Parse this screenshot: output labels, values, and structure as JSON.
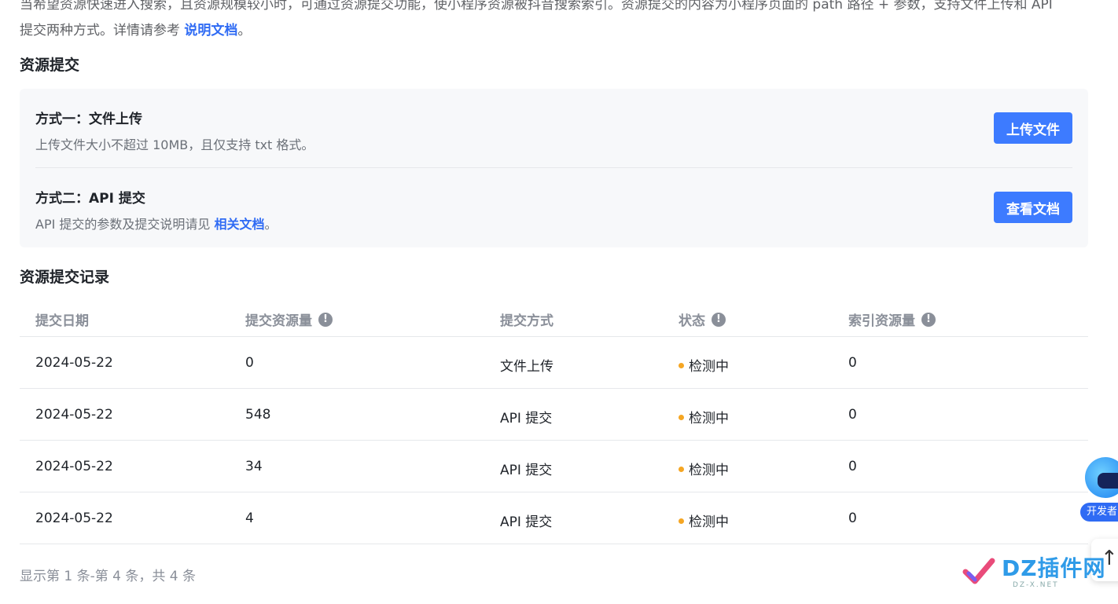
{
  "intro": {
    "line1": "当希望资源快速进入搜索，且资源规模较小时，可通过资源提交功能，使小程序资源被抖音搜索索引。资源提交的内容为小程序页面的 path 路径 + 参数，支持文件上传和 API",
    "line2_prefix": "提交两种方式。详情请参考 ",
    "line2_link": "说明文档",
    "line2_suffix": "。"
  },
  "submit_section": {
    "title": "资源提交",
    "method1": {
      "title": "方式一：文件上传",
      "desc": "上传文件大小不超过 10MB，且仅支持 txt 格式。",
      "button": "上传文件"
    },
    "method2": {
      "title": "方式二：API 提交",
      "desc_prefix": "API 提交的参数及提交说明请见 ",
      "desc_link": "相关文档",
      "desc_suffix": "。",
      "button": "查看文档"
    }
  },
  "records": {
    "title": "资源提交记录",
    "headers": [
      "提交日期",
      "提交资源量",
      "提交方式",
      "状态",
      "索引资源量"
    ],
    "info_icon": "!",
    "rows": [
      {
        "date": "2024-05-22",
        "count": "0",
        "method": "文件上传",
        "status": "检测中",
        "indexed": "0"
      },
      {
        "date": "2024-05-22",
        "count": "548",
        "method": "API 提交",
        "status": "检测中",
        "indexed": "0"
      },
      {
        "date": "2024-05-22",
        "count": "34",
        "method": "API 提交",
        "status": "检测中",
        "indexed": "0"
      },
      {
        "date": "2024-05-22",
        "count": "4",
        "method": "API 提交",
        "status": "检测中",
        "indexed": "0"
      }
    ],
    "pagination": "显示第 1 条-第 4 条，共 4 条"
  },
  "floating": {
    "assistant_label": "开发者",
    "back_to_top_icon": "arrow-up-icon",
    "back_to_top_glyph": "↑"
  },
  "watermark": {
    "text": "DZ插件网",
    "sub": "DZ-X.NET"
  },
  "colors": {
    "accent": "#3d7bff",
    "link": "#2f6bf4",
    "status_pending": "#f5a623"
  }
}
